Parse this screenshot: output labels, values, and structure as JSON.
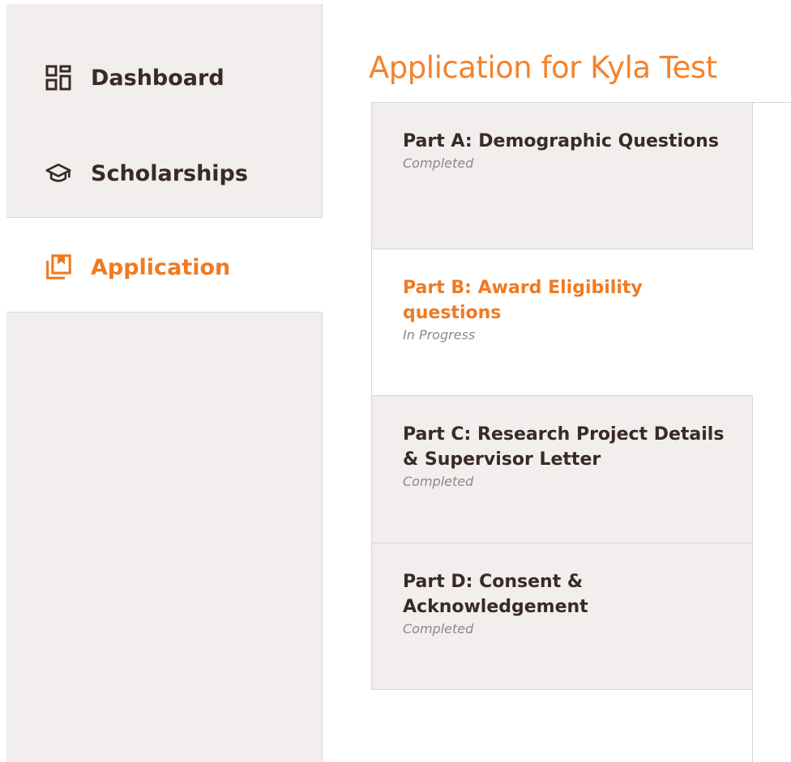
{
  "sidebar": {
    "items": [
      {
        "label": "Dashboard",
        "icon": "dashboard-icon",
        "active": false
      },
      {
        "label": "Scholarships",
        "icon": "graduation-cap-icon",
        "active": false
      },
      {
        "label": "Application",
        "icon": "application-icon",
        "active": true
      }
    ]
  },
  "main": {
    "title": "Application for Kyla Test",
    "parts": [
      {
        "title": "Part A: Demographic Questions",
        "status": "Completed",
        "active": false
      },
      {
        "title": "Part B: Award Eligibility questions",
        "status": "In Progress",
        "active": true
      },
      {
        "title": "Part C: Research Project Details & Supervisor Letter",
        "status": "Completed",
        "active": false
      },
      {
        "title": "Part D: Consent & Acknowledgement",
        "status": "Completed",
        "active": false
      }
    ]
  },
  "colors": {
    "accent": "#f07a20",
    "text_dark": "#3a2a25",
    "sidebar_bg": "#f1eeed",
    "status_gray": "#8a8a8a"
  }
}
